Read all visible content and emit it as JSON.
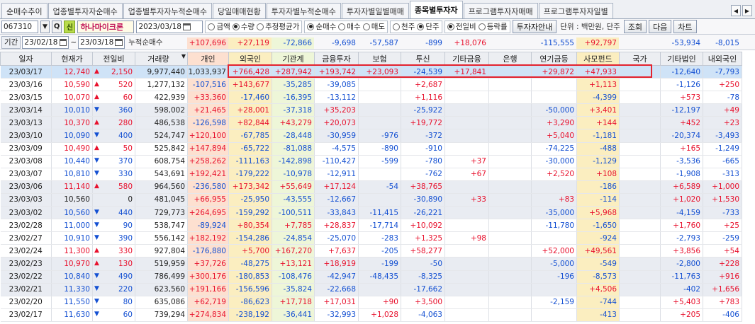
{
  "tabs": [
    {
      "label": "순매수추이",
      "active": false
    },
    {
      "label": "업종별투자자순매수",
      "active": false
    },
    {
      "label": "업종별투자자누적순매수",
      "active": false
    },
    {
      "label": "당일매매현황",
      "active": false
    },
    {
      "label": "투자자별누적순매수",
      "active": false
    },
    {
      "label": "투자자별일별매매",
      "active": false
    },
    {
      "label": "종목별투자자",
      "active": true
    },
    {
      "label": "프로그램투자자매매",
      "active": false
    },
    {
      "label": "프로그램투자자일별",
      "active": false
    }
  ],
  "tab_arrows": {
    "left": "◀",
    "right": "▶"
  },
  "toolbar": {
    "code": "067310",
    "code_dropdown": "▼",
    "search_glyph": "Q",
    "badge": "신",
    "stock_name": "하나마이크론",
    "date": "2023/03/18",
    "group1": [
      {
        "label": "금액",
        "on": false
      },
      {
        "label": "수량",
        "on": true
      },
      {
        "label": "추정평균가",
        "on": false
      }
    ],
    "group2": [
      {
        "label": "순매수",
        "on": true
      },
      {
        "label": "매수",
        "on": false
      },
      {
        "label": "매도",
        "on": false
      }
    ],
    "group3": [
      {
        "label": "천주",
        "on": false
      },
      {
        "label": "단주",
        "on": true
      }
    ],
    "group4": [
      {
        "label": "전일비",
        "on": true
      },
      {
        "label": "등락률",
        "on": false
      }
    ],
    "investor_guide": "투자자안내",
    "unit": "단위 : 백만원, 단주",
    "buttons": {
      "query": "조회",
      "next": "다음",
      "chart": "차트"
    }
  },
  "period": {
    "label": "기간",
    "from": "23/02/18",
    "tilde": "~",
    "to": "23/03/18",
    "cum_label": "누적순매수"
  },
  "cumulative": [
    {
      "key": "individual",
      "value": "+107,696",
      "color": "#e8112d",
      "bg": "#fde0d0"
    },
    {
      "key": "foreign",
      "value": "+27,119",
      "color": "#e8112d",
      "bg": "#fbeec0"
    },
    {
      "key": "institution",
      "value": "-72,866",
      "color": "#1450d2",
      "bg": "#eef6d8"
    },
    {
      "key": "financial",
      "value": "-9,698",
      "color": "#1450d2",
      "bg": ""
    },
    {
      "key": "insurance",
      "value": "-57,587",
      "color": "#1450d2",
      "bg": ""
    },
    {
      "key": "trust",
      "value": "-899",
      "color": "#1450d2",
      "bg": ""
    },
    {
      "key": "otherfin",
      "value": "+18,076",
      "color": "#e8112d",
      "bg": ""
    },
    {
      "key": "bank",
      "value": "",
      "color": "#222",
      "bg": ""
    },
    {
      "key": "pension",
      "value": "-115,555",
      "color": "#1450d2",
      "bg": ""
    },
    {
      "key": "privfund",
      "value": "+92,797",
      "color": "#e8112d",
      "bg": "#fbeec0"
    },
    {
      "key": "govt",
      "value": "",
      "color": "#222",
      "bg": ""
    },
    {
      "key": "othercorp",
      "value": "-53,934",
      "color": "#1450d2",
      "bg": ""
    },
    {
      "key": "domesticforeign",
      "value": "-8,015",
      "color": "#1450d2",
      "bg": ""
    }
  ],
  "columns": [
    "일자",
    "현재가",
    "전일비",
    "거래량",
    "개인",
    "외국인",
    "기관계",
    "금융투자",
    "보험",
    "투신",
    "기타금융",
    "은행",
    "연기금등",
    "사모펀드",
    "국가",
    "기타법인",
    "내외국인"
  ],
  "column_bgs": [
    "",
    "",
    "",
    "",
    "#fde0d0",
    "#fbeec0",
    "#eef6d8",
    "",
    "",
    "",
    "",
    "",
    "",
    "#fbeec0",
    "",
    "",
    ""
  ],
  "volume_sort_icon": "▼",
  "rows": [
    [
      "23/03/17",
      "12,740",
      "u",
      "2,150",
      "9,977,440",
      "1,033,937",
      "+766,428",
      "+287,942",
      "+193,742",
      "+23,093",
      "-24,539",
      "+17,841",
      "",
      "+29,872",
      "+47,933",
      "",
      "-12,640",
      "-7,793"
    ],
    [
      "23/03/16",
      "10,590",
      "u",
      "520",
      "1,277,132",
      "-107,516",
      "+143,677",
      "-35,285",
      "-39,085",
      "",
      "+2,687",
      "",
      "",
      "",
      "+1,113",
      "",
      "-1,126",
      "+250"
    ],
    [
      "23/03/15",
      "10,070",
      "u",
      "60",
      "422,939",
      "+33,360",
      "-17,460",
      "-16,395",
      "-13,112",
      "",
      "+1,116",
      "",
      "",
      "",
      "-4,399",
      "",
      "+573",
      "-78"
    ],
    [
      "23/03/14",
      "10,010",
      "d",
      "360",
      "598,002",
      "+21,465",
      "+28,001",
      "-37,318",
      "+35,203",
      "",
      "-25,922",
      "",
      "",
      "-50,000",
      "+3,401",
      "",
      "-12,197",
      "+49"
    ],
    [
      "23/03/13",
      "10,370",
      "u",
      "280",
      "486,538",
      "-126,598",
      "+82,844",
      "+43,279",
      "+20,073",
      "",
      "+19,772",
      "",
      "",
      "+3,290",
      "+144",
      "",
      "+452",
      "+23"
    ],
    [
      "23/03/10",
      "10,090",
      "d",
      "400",
      "524,747",
      "+120,100",
      "-67,785",
      "-28,448",
      "-30,959",
      "-976",
      "-372",
      "",
      "",
      "+5,040",
      "-1,181",
      "",
      "-20,374",
      "-3,493"
    ],
    [
      "23/03/09",
      "10,490",
      "u",
      "50",
      "525,842",
      "+147,894",
      "-65,722",
      "-81,088",
      "-4,575",
      "-890",
      "-910",
      "",
      "",
      "-74,225",
      "-488",
      "",
      "+165",
      "-1,249"
    ],
    [
      "23/03/08",
      "10,440",
      "d",
      "370",
      "608,754",
      "+258,262",
      "-111,163",
      "-142,898",
      "-110,427",
      "-599",
      "-780",
      "+37",
      "",
      "-30,000",
      "-1,129",
      "",
      "-3,536",
      "-665"
    ],
    [
      "23/03/07",
      "10,810",
      "d",
      "330",
      "543,691",
      "+192,421",
      "-179,222",
      "-10,978",
      "-12,911",
      "",
      "-762",
      "+67",
      "",
      "+2,520",
      "+108",
      "",
      "-1,908",
      "-313"
    ],
    [
      "23/03/06",
      "11,140",
      "u",
      "580",
      "964,560",
      "-236,580",
      "+173,342",
      "+55,649",
      "+17,124",
      "-54",
      "+38,765",
      "",
      "",
      "",
      "-186",
      "",
      "+6,589",
      "+1,000"
    ],
    [
      "23/03/03",
      "10,560",
      "f",
      "0",
      "481,045",
      "+66,955",
      "-25,950",
      "-43,555",
      "-12,667",
      "",
      "-30,890",
      "+33",
      "",
      "+83",
      "-114",
      "",
      "+1,020",
      "+1,530"
    ],
    [
      "23/03/02",
      "10,560",
      "d",
      "440",
      "729,773",
      "+264,695",
      "-159,292",
      "-100,511",
      "-33,843",
      "-11,415",
      "-26,221",
      "",
      "",
      "-35,000",
      "+5,968",
      "",
      "-4,159",
      "-733"
    ],
    [
      "23/02/28",
      "11,000",
      "d",
      "90",
      "538,747",
      "-89,924",
      "+80,354",
      "+7,785",
      "+28,837",
      "-17,714",
      "+10,092",
      "",
      "",
      "-11,780",
      "-1,650",
      "",
      "+1,760",
      "+25"
    ],
    [
      "23/02/27",
      "10,910",
      "d",
      "390",
      "556,142",
      "+182,192",
      "-154,286",
      "-24,854",
      "-25,070",
      "-283",
      "+1,325",
      "+98",
      "",
      "",
      "-924",
      "",
      "-2,793",
      "-259"
    ],
    [
      "23/02/24",
      "11,300",
      "u",
      "330",
      "927,804",
      "-176,880",
      "+5,700",
      "+167,270",
      "+7,637",
      "-205",
      "+58,277",
      "",
      "",
      "+52,000",
      "+49,561",
      "",
      "+3,856",
      "+54"
    ],
    [
      "23/02/23",
      "10,970",
      "u",
      "130",
      "519,959",
      "+37,726",
      "-48,275",
      "+13,121",
      "+18,919",
      "-199",
      "-50",
      "",
      "",
      "-5,000",
      "-549",
      "",
      "-2,800",
      "+228"
    ],
    [
      "23/02/22",
      "10,840",
      "d",
      "490",
      "786,499",
      "+300,176",
      "-180,853",
      "-108,476",
      "-42,947",
      "-48,435",
      "-8,325",
      "",
      "",
      "-196",
      "-8,573",
      "",
      "-11,763",
      "+916"
    ],
    [
      "23/02/21",
      "11,330",
      "d",
      "220",
      "623,560",
      "+191,166",
      "-156,596",
      "-35,824",
      "-22,668",
      "",
      "-17,662",
      "",
      "",
      "",
      "+4,506",
      "",
      "-402",
      "+1,656"
    ],
    [
      "23/02/20",
      "11,550",
      "d",
      "80",
      "635,086",
      "+62,719",
      "-86,623",
      "+17,718",
      "+17,031",
      "+90",
      "+3,500",
      "",
      "",
      "-2,159",
      "-744",
      "",
      "+5,403",
      "+783"
    ],
    [
      "23/02/17",
      "11,630",
      "d",
      "60",
      "739,294",
      "+274,834",
      "-238,192",
      "-36,441",
      "-32,993",
      "+1,028",
      "-4,063",
      "",
      "",
      "",
      "-413",
      "",
      "+205",
      "-406"
    ]
  ],
  "arrows": {
    "u": "▲",
    "d": "▼",
    "f": ""
  },
  "colors": {
    "up": "#e8112d",
    "down": "#1450d2",
    "highlight": "#e3222e",
    "selected_row": "#cfe3f7"
  }
}
